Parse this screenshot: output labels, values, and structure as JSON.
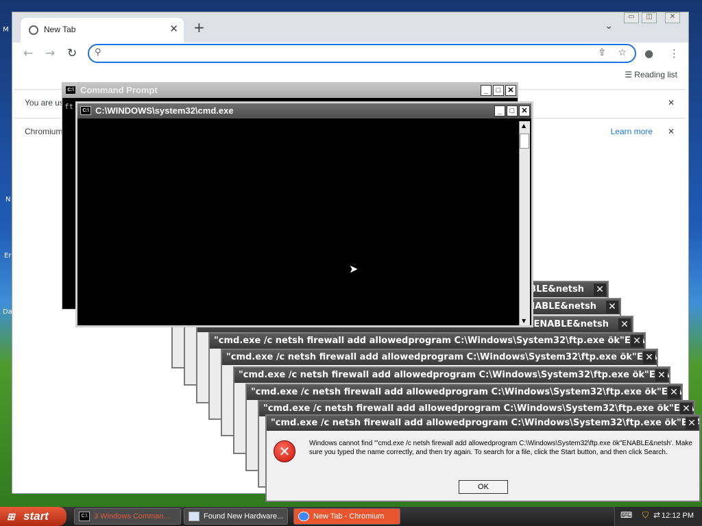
{
  "desktop": {
    "labels": [
      "M",
      "N",
      "Er",
      "Da"
    ]
  },
  "chromium": {
    "tab_title": "New Tab",
    "tab_close": "✕",
    "new_tab": "+",
    "tab_menu": "⌄",
    "window_controls": [
      "▭",
      "◫",
      "✕"
    ],
    "nav": {
      "back": "←",
      "forward": "→",
      "reload": "↻"
    },
    "omnibox": {
      "placeholder": "",
      "value": ""
    },
    "reading_list": "Reading list",
    "infobar1": {
      "text": "You are us",
      "close": "✕"
    },
    "infobar2": {
      "text": "Chromium",
      "learn_more": "Learn more",
      "close": "✕"
    }
  },
  "cmd_back": {
    "title": "Command Prompt",
    "text": "ft",
    "controls": [
      "_",
      "□",
      "✕"
    ]
  },
  "cmd_front": {
    "title": "C:\\WINDOWS\\system32\\cmd.exe",
    "controls": [
      "_",
      "□",
      "✕"
    ]
  },
  "dialog_title": "\"cmd.exe /c netsh firewall add allowedprogram C:\\Windows\\System32\\ftp.exe ök\"ENABLE&netsh",
  "dialog_title_partial": [
    "ABLE&netsh",
    "ENABLE&netsh",
    "ök\"ENABLE&netsh"
  ],
  "error": {
    "message": "Windows cannot find '\"cmd.exe /c netsh firewall add allowedprogram C:\\Windows\\System32\\ftp.exe ök\"ENABLE&netsh'. Make sure you typed the name correctly, and then try again. To search for a file, click the Start button, and then click Search.",
    "ok": "OK",
    "close": "✕",
    "icon": "✕"
  },
  "taskbar": {
    "start": "start",
    "items": [
      {
        "label": "3 Windows Comman...",
        "icon": "C:\\"
      },
      {
        "label": "Found New Hardware...",
        "icon": ""
      },
      {
        "label": "New Tab - Chromium",
        "icon": ""
      }
    ],
    "clock": "12:12 PM"
  },
  "colors": {
    "accent": "#1a73e8",
    "start": "#c8381c",
    "error": "#d01b0d"
  }
}
